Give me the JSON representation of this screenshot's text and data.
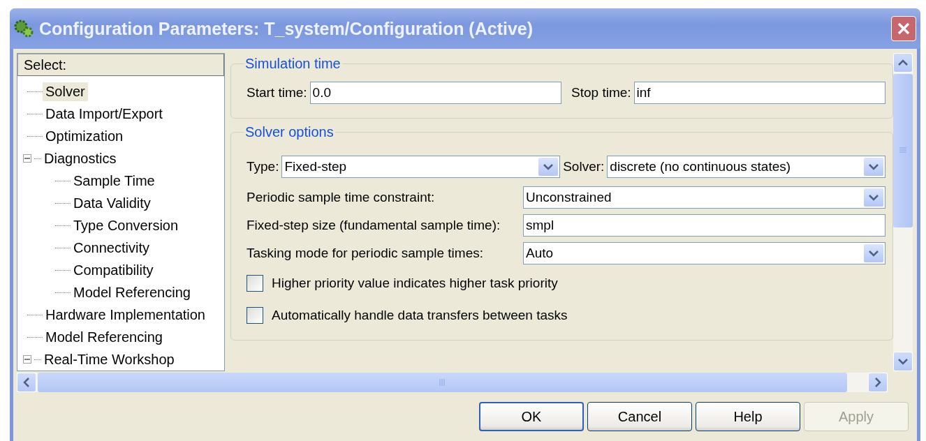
{
  "window": {
    "title": "Configuration Parameters: T_system/Configuration (Active)"
  },
  "tree": {
    "header": "Select:",
    "items": [
      {
        "label": "Solver",
        "selected": true
      },
      {
        "label": "Data Import/Export",
        "selected": false
      },
      {
        "label": "Optimization",
        "selected": false
      },
      {
        "label": "Diagnostics",
        "selected": false,
        "expanded": true,
        "children": [
          {
            "label": "Sample Time",
            "selected": false
          },
          {
            "label": "Data Validity",
            "selected": false
          },
          {
            "label": "Type Conversion",
            "selected": false
          },
          {
            "label": "Connectivity",
            "selected": false
          },
          {
            "label": "Compatibility",
            "selected": false
          },
          {
            "label": "Model Referencing",
            "selected": false
          }
        ]
      },
      {
        "label": "Hardware Implementation",
        "selected": false
      },
      {
        "label": "Model Referencing",
        "selected": false
      },
      {
        "label": "Real-Time Workshop",
        "selected": false,
        "expanded": true
      }
    ]
  },
  "simulation_time": {
    "title": "Simulation time",
    "start_time": {
      "label": "Start time:",
      "value": "0.0"
    },
    "stop_time": {
      "label": "Stop time:",
      "value": "inf"
    }
  },
  "solver_options": {
    "title": "Solver options",
    "type": {
      "label": "Type:",
      "value": "Fixed-step"
    },
    "solver": {
      "label": "Solver:",
      "value": "discrete (no continuous states)"
    },
    "rows": [
      {
        "kind": "dropdown",
        "label": "Periodic sample time constraint:",
        "value": "Unconstrained"
      },
      {
        "kind": "text",
        "label": "Fixed-step size (fundamental sample time):",
        "value": "smpl"
      },
      {
        "kind": "dropdown",
        "label": "Tasking mode for periodic sample times:",
        "value": "Auto"
      }
    ],
    "checkboxes": [
      {
        "label": "Higher priority value indicates higher task priority",
        "checked": false
      },
      {
        "label": "Automatically handle data transfers between tasks",
        "checked": false
      }
    ]
  },
  "buttons": [
    {
      "label": "OK",
      "disabled": false,
      "default": true
    },
    {
      "label": "Cancel",
      "disabled": false,
      "default": false
    },
    {
      "label": "Help",
      "disabled": false,
      "default": false
    },
    {
      "label": "Apply",
      "disabled": true,
      "default": false
    }
  ]
}
